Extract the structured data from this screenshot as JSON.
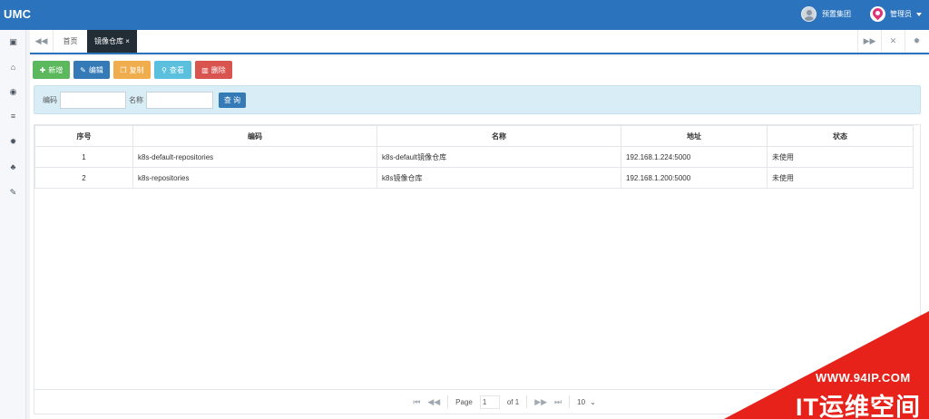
{
  "app": {
    "logo": "UMC"
  },
  "header": {
    "org_label": "预置集团",
    "user_label": "管理员"
  },
  "sidebar": {
    "items": [
      {
        "icon": "id-card-icon",
        "glyph": "▣"
      },
      {
        "icon": "bank-icon",
        "glyph": "⌂"
      },
      {
        "icon": "eye-icon",
        "glyph": "◉"
      },
      {
        "icon": "list-icon",
        "glyph": "≡"
      },
      {
        "icon": "gear-icon",
        "glyph": "✹"
      },
      {
        "icon": "sitemap-icon",
        "glyph": "♣"
      },
      {
        "icon": "wrench-icon",
        "glyph": "✎"
      }
    ]
  },
  "tabs": {
    "home_label": "首页",
    "active_label": "镜像仓库",
    "close_glyph": "×"
  },
  "toolbar": {
    "add_label": "新增",
    "edit_label": "编辑",
    "copy_label": "复制",
    "view_label": "查看",
    "delete_label": "删除"
  },
  "search": {
    "code_label": "编码",
    "name_label": "名称",
    "code_value": "",
    "name_value": "",
    "button_label": "查 询"
  },
  "table": {
    "columns": [
      "序号",
      "编码",
      "名称",
      "地址",
      "状态"
    ],
    "rows": [
      {
        "index": "1",
        "code": "k8s-default-repositories",
        "name": "k8s-default镜像仓库",
        "address": "192.168.1.224:5000",
        "status": "未使用"
      },
      {
        "index": "2",
        "code": "k8s-repositories",
        "name": "k8s镜像仓库",
        "address": "192.168.1.200:5000",
        "status": "未使用"
      }
    ]
  },
  "pager": {
    "page_label": "Page",
    "page_value": "1",
    "of_label": "of 1",
    "page_size": "10"
  },
  "watermark": {
    "url": "WWW.94IP.COM",
    "text": "IT运维空间",
    "color": "#e6221b"
  },
  "colors": {
    "brand": "#2b73bc",
    "add": "#5cb85c",
    "edit": "#337ab7",
    "copy": "#f0ad4e",
    "view": "#5bc0de",
    "delete": "#d9534f"
  }
}
